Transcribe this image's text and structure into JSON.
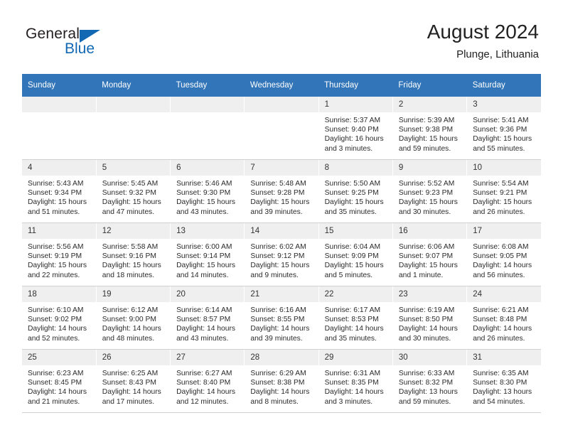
{
  "brand": {
    "name_part1": "General",
    "name_part2": "Blue",
    "triangle_color": "#1268b3"
  },
  "header": {
    "title": "August 2024",
    "location": "Plunge, Lithuania"
  },
  "theme": {
    "header_band": "#3275b8",
    "daynum_strip": "#efefef",
    "grid_line": "#d0d0d0"
  },
  "weekday_headers": [
    "Sunday",
    "Monday",
    "Tuesday",
    "Wednesday",
    "Thursday",
    "Friday",
    "Saturday"
  ],
  "labels": {
    "sunrise_prefix": "Sunrise:",
    "sunset_prefix": "Sunset:",
    "daylight_prefix": "Daylight:"
  },
  "weeks": [
    [
      {
        "day": "",
        "empty": true
      },
      {
        "day": "",
        "empty": true
      },
      {
        "day": "",
        "empty": true
      },
      {
        "day": "",
        "empty": true
      },
      {
        "day": "1",
        "sunrise": "Sunrise: 5:37 AM",
        "sunset": "Sunset: 9:40 PM",
        "daylight": "Daylight: 16 hours and 3 minutes."
      },
      {
        "day": "2",
        "sunrise": "Sunrise: 5:39 AM",
        "sunset": "Sunset: 9:38 PM",
        "daylight": "Daylight: 15 hours and 59 minutes."
      },
      {
        "day": "3",
        "sunrise": "Sunrise: 5:41 AM",
        "sunset": "Sunset: 9:36 PM",
        "daylight": "Daylight: 15 hours and 55 minutes."
      }
    ],
    [
      {
        "day": "4",
        "sunrise": "Sunrise: 5:43 AM",
        "sunset": "Sunset: 9:34 PM",
        "daylight": "Daylight: 15 hours and 51 minutes."
      },
      {
        "day": "5",
        "sunrise": "Sunrise: 5:45 AM",
        "sunset": "Sunset: 9:32 PM",
        "daylight": "Daylight: 15 hours and 47 minutes."
      },
      {
        "day": "6",
        "sunrise": "Sunrise: 5:46 AM",
        "sunset": "Sunset: 9:30 PM",
        "daylight": "Daylight: 15 hours and 43 minutes."
      },
      {
        "day": "7",
        "sunrise": "Sunrise: 5:48 AM",
        "sunset": "Sunset: 9:28 PM",
        "daylight": "Daylight: 15 hours and 39 minutes."
      },
      {
        "day": "8",
        "sunrise": "Sunrise: 5:50 AM",
        "sunset": "Sunset: 9:25 PM",
        "daylight": "Daylight: 15 hours and 35 minutes."
      },
      {
        "day": "9",
        "sunrise": "Sunrise: 5:52 AM",
        "sunset": "Sunset: 9:23 PM",
        "daylight": "Daylight: 15 hours and 30 minutes."
      },
      {
        "day": "10",
        "sunrise": "Sunrise: 5:54 AM",
        "sunset": "Sunset: 9:21 PM",
        "daylight": "Daylight: 15 hours and 26 minutes."
      }
    ],
    [
      {
        "day": "11",
        "sunrise": "Sunrise: 5:56 AM",
        "sunset": "Sunset: 9:19 PM",
        "daylight": "Daylight: 15 hours and 22 minutes."
      },
      {
        "day": "12",
        "sunrise": "Sunrise: 5:58 AM",
        "sunset": "Sunset: 9:16 PM",
        "daylight": "Daylight: 15 hours and 18 minutes."
      },
      {
        "day": "13",
        "sunrise": "Sunrise: 6:00 AM",
        "sunset": "Sunset: 9:14 PM",
        "daylight": "Daylight: 15 hours and 14 minutes."
      },
      {
        "day": "14",
        "sunrise": "Sunrise: 6:02 AM",
        "sunset": "Sunset: 9:12 PM",
        "daylight": "Daylight: 15 hours and 9 minutes."
      },
      {
        "day": "15",
        "sunrise": "Sunrise: 6:04 AM",
        "sunset": "Sunset: 9:09 PM",
        "daylight": "Daylight: 15 hours and 5 minutes."
      },
      {
        "day": "16",
        "sunrise": "Sunrise: 6:06 AM",
        "sunset": "Sunset: 9:07 PM",
        "daylight": "Daylight: 15 hours and 1 minute."
      },
      {
        "day": "17",
        "sunrise": "Sunrise: 6:08 AM",
        "sunset": "Sunset: 9:05 PM",
        "daylight": "Daylight: 14 hours and 56 minutes."
      }
    ],
    [
      {
        "day": "18",
        "sunrise": "Sunrise: 6:10 AM",
        "sunset": "Sunset: 9:02 PM",
        "daylight": "Daylight: 14 hours and 52 minutes."
      },
      {
        "day": "19",
        "sunrise": "Sunrise: 6:12 AM",
        "sunset": "Sunset: 9:00 PM",
        "daylight": "Daylight: 14 hours and 48 minutes."
      },
      {
        "day": "20",
        "sunrise": "Sunrise: 6:14 AM",
        "sunset": "Sunset: 8:57 PM",
        "daylight": "Daylight: 14 hours and 43 minutes."
      },
      {
        "day": "21",
        "sunrise": "Sunrise: 6:16 AM",
        "sunset": "Sunset: 8:55 PM",
        "daylight": "Daylight: 14 hours and 39 minutes."
      },
      {
        "day": "22",
        "sunrise": "Sunrise: 6:17 AM",
        "sunset": "Sunset: 8:53 PM",
        "daylight": "Daylight: 14 hours and 35 minutes."
      },
      {
        "day": "23",
        "sunrise": "Sunrise: 6:19 AM",
        "sunset": "Sunset: 8:50 PM",
        "daylight": "Daylight: 14 hours and 30 minutes."
      },
      {
        "day": "24",
        "sunrise": "Sunrise: 6:21 AM",
        "sunset": "Sunset: 8:48 PM",
        "daylight": "Daylight: 14 hours and 26 minutes."
      }
    ],
    [
      {
        "day": "25",
        "sunrise": "Sunrise: 6:23 AM",
        "sunset": "Sunset: 8:45 PM",
        "daylight": "Daylight: 14 hours and 21 minutes."
      },
      {
        "day": "26",
        "sunrise": "Sunrise: 6:25 AM",
        "sunset": "Sunset: 8:43 PM",
        "daylight": "Daylight: 14 hours and 17 minutes."
      },
      {
        "day": "27",
        "sunrise": "Sunrise: 6:27 AM",
        "sunset": "Sunset: 8:40 PM",
        "daylight": "Daylight: 14 hours and 12 minutes."
      },
      {
        "day": "28",
        "sunrise": "Sunrise: 6:29 AM",
        "sunset": "Sunset: 8:38 PM",
        "daylight": "Daylight: 14 hours and 8 minutes."
      },
      {
        "day": "29",
        "sunrise": "Sunrise: 6:31 AM",
        "sunset": "Sunset: 8:35 PM",
        "daylight": "Daylight: 14 hours and 3 minutes."
      },
      {
        "day": "30",
        "sunrise": "Sunrise: 6:33 AM",
        "sunset": "Sunset: 8:32 PM",
        "daylight": "Daylight: 13 hours and 59 minutes."
      },
      {
        "day": "31",
        "sunrise": "Sunrise: 6:35 AM",
        "sunset": "Sunset: 8:30 PM",
        "daylight": "Daylight: 13 hours and 54 minutes."
      }
    ]
  ]
}
